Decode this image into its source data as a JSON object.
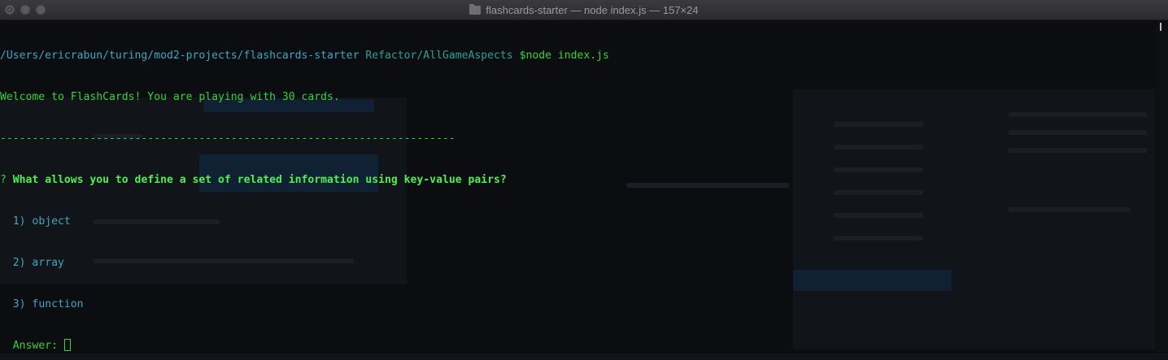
{
  "window": {
    "title": "flashcards-starter — node index.js — 157×24"
  },
  "terminal": {
    "cwd": "/Users/ericrabun/turing/mod2-projects/flashcards-starter",
    "branch": "Refactor/AllGameAspects",
    "command": "$node index.js",
    "welcome": "Welcome to FlashCards! You are playing with 30 cards.",
    "divider": "-----------------------------------------------------------------------",
    "question_mark": "?",
    "question": "What allows you to define a set of related information using key-value pairs?",
    "options": [
      "1) object",
      "2) array",
      "3) function"
    ],
    "answer_label": "Answer:"
  },
  "colors": {
    "prompt_green": "#38d33a",
    "path_cyan": "#3fa7c2",
    "branch_teal": "#2aa198",
    "background": "#0b0d10"
  }
}
